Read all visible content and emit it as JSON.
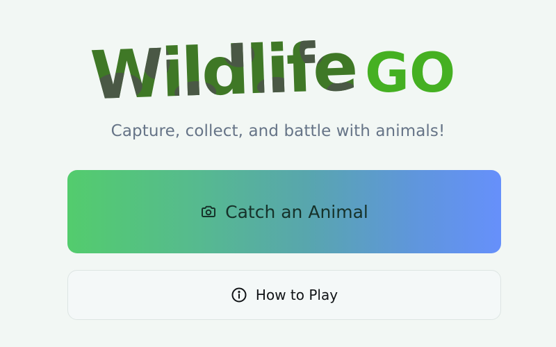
{
  "logo": {
    "word": "Wildlife",
    "suffix": "GO",
    "colors": {
      "camo_dark": "#4a5845",
      "camo_green": "#3f7826",
      "go_green": "#45b022"
    }
  },
  "tagline": "Capture, collect, and battle with animals!",
  "actions": {
    "catch": {
      "label": "Catch an Animal",
      "icon": "camera-icon"
    },
    "how_to_play": {
      "label": "How to Play",
      "icon": "info-icon"
    }
  }
}
